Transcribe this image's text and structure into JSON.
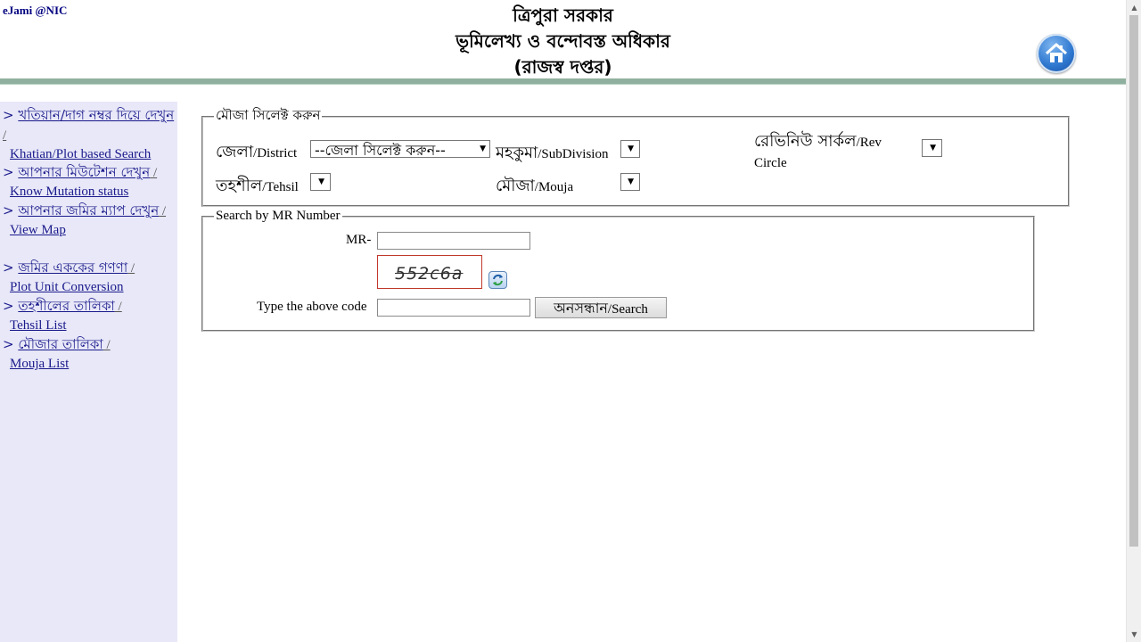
{
  "header": {
    "brand": "eJami @NIC",
    "title_line1": "ত্রিপুরা সরকার",
    "title_line2": "ভূমিলেখ্য ও বন্দোবস্ত অধিকার",
    "title_line3": "(রাজস্ব দপ্তর)",
    "home_icon": "home-icon"
  },
  "sidebar": {
    "items": [
      {
        "prefix": "> ",
        "bn": "খতিয়ান/দাগ নম্বর দিয়ে দেখুন",
        "en": "Khatian/Plot based Search"
      },
      {
        "prefix": "> ",
        "bn": "আপনার মিউটেশন দেখুন",
        "en": "Know Mutation status"
      },
      {
        "prefix": "> ",
        "bn": "আপনার জমির ম্যাপ দেখুন",
        "en": "View Map"
      },
      {
        "prefix": "> ",
        "bn": "জমির এককের গণণা",
        "en": "Plot Unit Conversion"
      },
      {
        "prefix": "> ",
        "bn": "তহশীলের তালিকা",
        "en": "Tehsil List"
      },
      {
        "prefix": "> ",
        "bn": "মৌজার তালিকা",
        "en": "Mouja List"
      }
    ],
    "separator": " /"
  },
  "mouza_form": {
    "legend": "মৌজা সিলেক্ট করুন",
    "district": {
      "bn": "জেলা",
      "en": "/District",
      "selected": "--জেলা সিলেক্ট করুন--"
    },
    "subdivision": {
      "bn": "মহকুমা",
      "en": "/SubDivision",
      "selected": ""
    },
    "rev_circle": {
      "bn": "রেভিনিউ সার্কল",
      "en": "/Rev",
      "en2": "Circle",
      "selected": ""
    },
    "tehsil": {
      "bn": "তহশীল",
      "en": "/Tehsil",
      "selected": ""
    },
    "mouja": {
      "bn": "মৌজা",
      "en": "/Mouja",
      "selected": ""
    }
  },
  "mr_form": {
    "legend": "Search by MR Number",
    "mr_label": "MR-",
    "mr_value": "",
    "captcha_text": "552c6a",
    "captcha_label": "Type the above code",
    "captcha_value": "",
    "search_bn": "অনসন্ধান",
    "search_en": "/Search",
    "refresh_icon": "refresh-icon"
  },
  "colors": {
    "sidebar_bg": "#e8e8f8",
    "link": "#1a1a8c",
    "header_rule": "#8fb09e",
    "captcha_border": "#c0392b"
  }
}
